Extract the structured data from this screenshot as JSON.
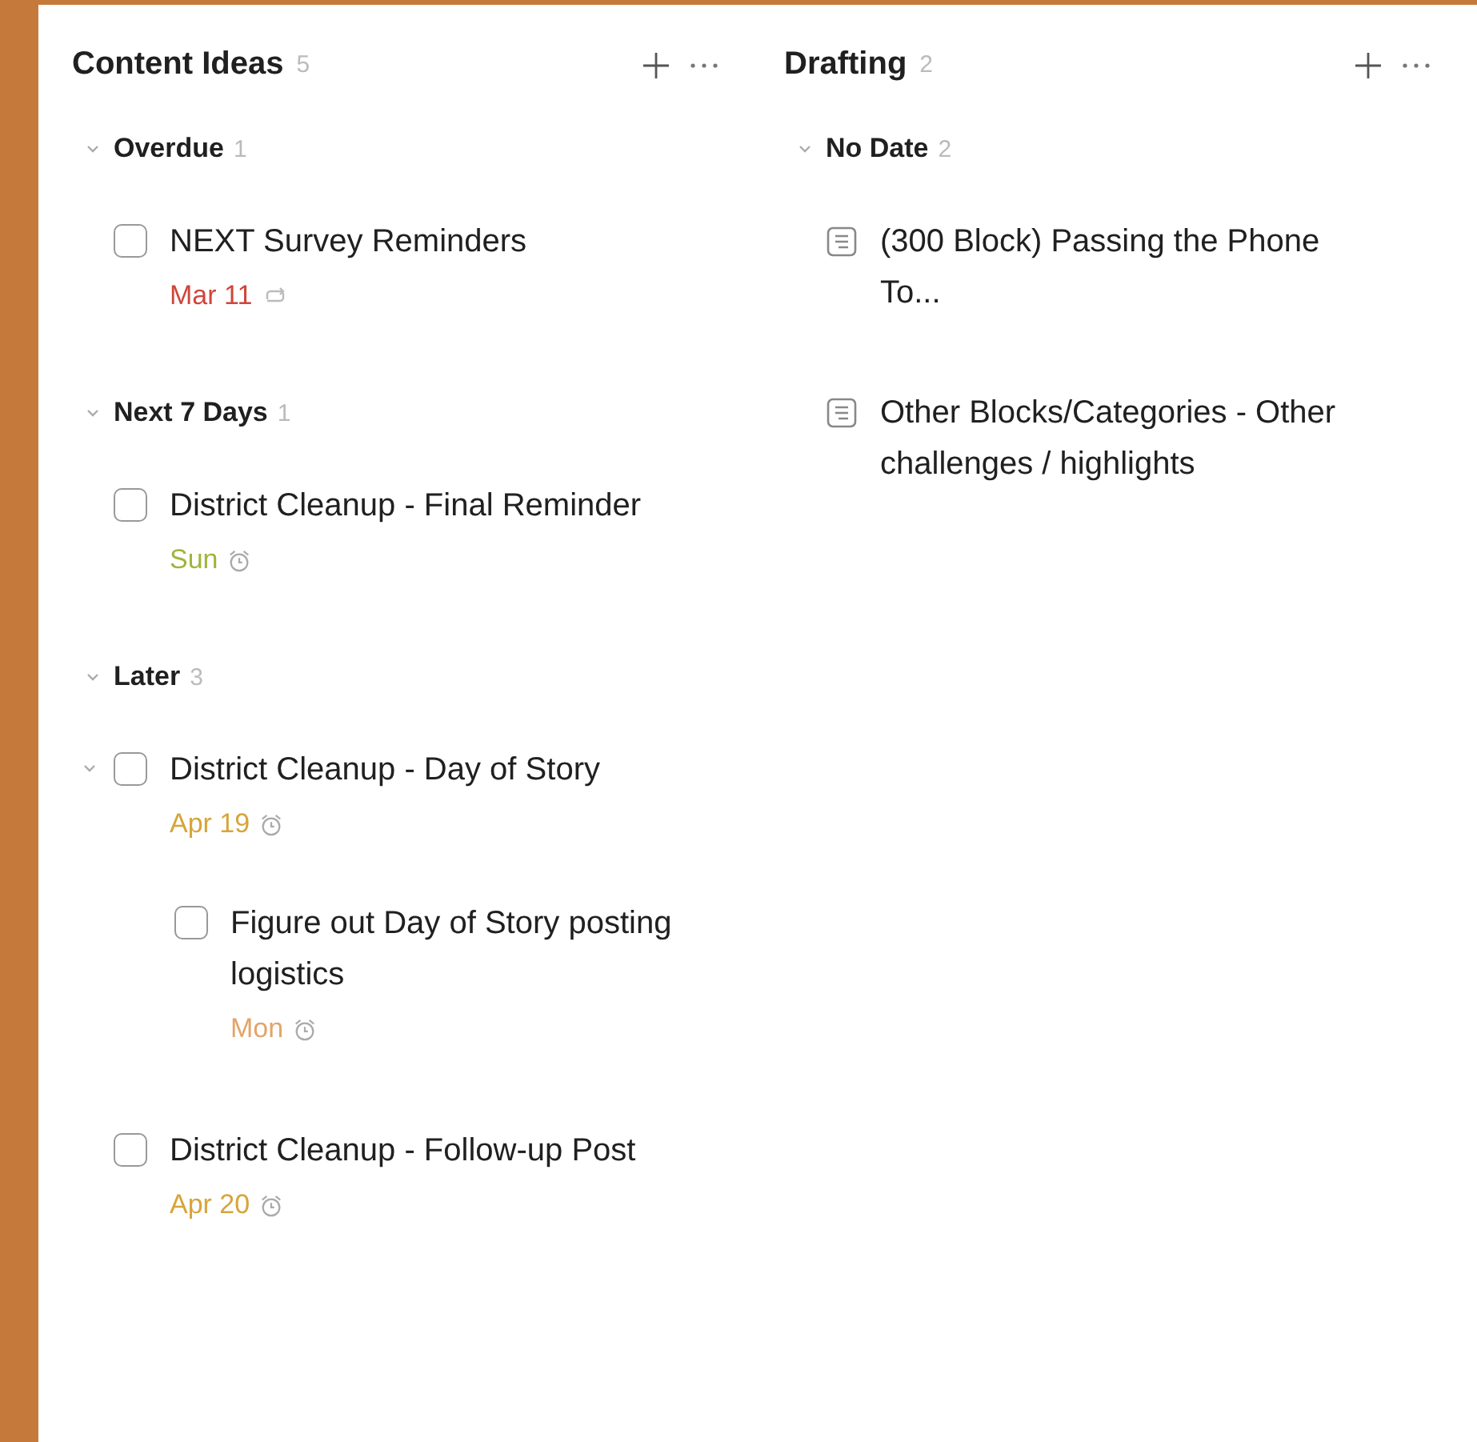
{
  "columns": [
    {
      "title": "Content Ideas",
      "count": "5",
      "sections": [
        {
          "title": "Overdue",
          "count": "1",
          "expanded": true,
          "tasks": [
            {
              "kind": "task",
              "title": "NEXT Survey Reminders",
              "checked": false,
              "due": {
                "text": "Mar 11",
                "color": "#d1453b",
                "kind": "repeat"
              }
            }
          ]
        },
        {
          "title": "Next 7 Days",
          "count": "1",
          "expanded": true,
          "tasks": [
            {
              "kind": "task",
              "title": "District Cleanup - Final Reminder",
              "checked": false,
              "due": {
                "text": "Sun",
                "color": "#a2b33a",
                "kind": "alarm"
              }
            }
          ]
        },
        {
          "title": "Later",
          "count": "3",
          "expanded": true,
          "tasks": [
            {
              "kind": "task",
              "title": "District Cleanup - Day of Story",
              "checked": false,
              "expanded": true,
              "due": {
                "text": "Apr 19",
                "color": "#d6a53a",
                "kind": "alarm"
              },
              "children": [
                {
                  "kind": "task",
                  "title": "Figure out Day of Story posting logistics",
                  "checked": false,
                  "due": {
                    "text": "Mon",
                    "color": "#e3a46a",
                    "kind": "alarm"
                  }
                }
              ]
            },
            {
              "kind": "task",
              "title": "District Cleanup - Follow-up Post",
              "checked": false,
              "due": {
                "text": "Apr 20",
                "color": "#d6a53a",
                "kind": "alarm"
              }
            }
          ]
        }
      ]
    },
    {
      "title": "Drafting",
      "count": "2",
      "sections": [
        {
          "title": "No Date",
          "count": "2",
          "expanded": true,
          "tasks": [
            {
              "kind": "note",
              "title": "(300 Block) Passing the Phone To..."
            },
            {
              "kind": "note",
              "title": "Other Blocks/Categories - Other challenges / highlights"
            }
          ]
        }
      ]
    }
  ]
}
